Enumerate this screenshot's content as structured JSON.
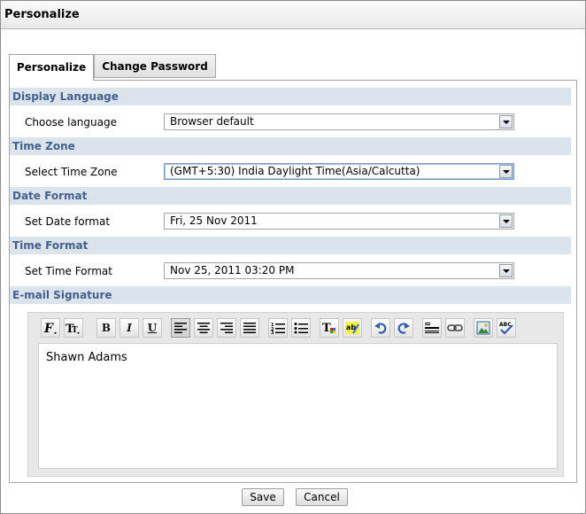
{
  "window": {
    "title": "Personalize"
  },
  "tabs": [
    {
      "label": "Personalize",
      "active": true
    },
    {
      "label": "Change Password",
      "active": false
    }
  ],
  "sections": {
    "display_language": {
      "title": "Display Language",
      "label": "Choose language",
      "value": "Browser default"
    },
    "time_zone": {
      "title": "Time Zone",
      "label": "Select Time Zone",
      "value": "(GMT+5:30) India Daylight Time(Asia/Calcutta)"
    },
    "date_format": {
      "title": "Date Format",
      "label": "Set Date format",
      "value": "Fri, 25 Nov 2011"
    },
    "time_format": {
      "title": "Time Format",
      "label": "Set Time Format",
      "value": "Nov 25, 2011 03:20 PM"
    },
    "email_signature": {
      "title": "E-mail Signature",
      "content": "Shawn Adams"
    }
  },
  "toolbar": {
    "bold": "B",
    "italic": "I",
    "underline": "U"
  },
  "buttons": {
    "save": "Save",
    "cancel": "Cancel"
  },
  "colors": {
    "section_bg": "#dbe3ec",
    "section_text": "#44618d",
    "editor_bg": "#e8e8e8"
  }
}
